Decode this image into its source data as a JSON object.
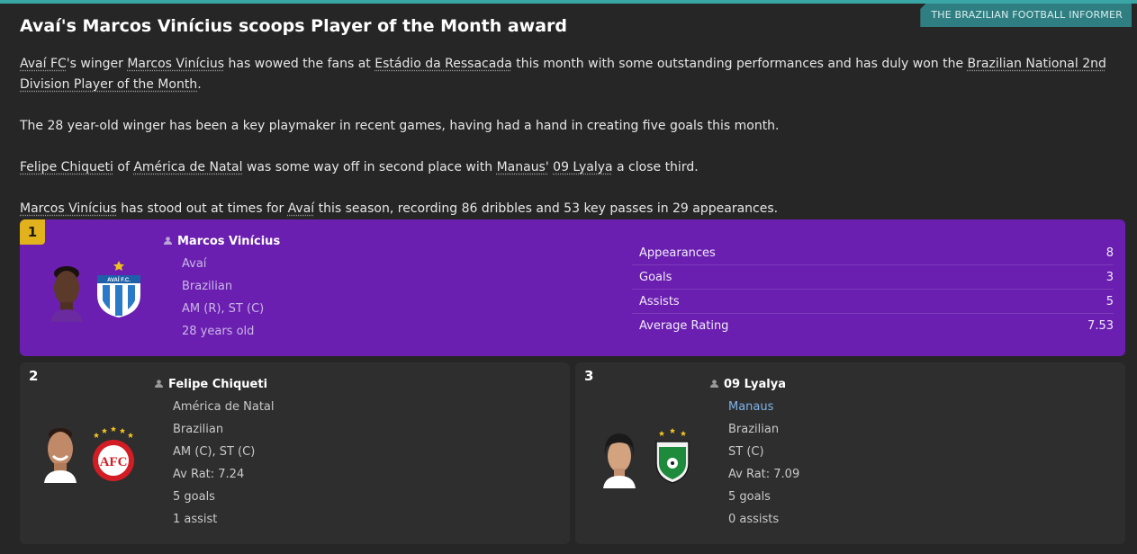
{
  "source": "THE BRAZILIAN FOOTBALL INFORMER",
  "headline": "Avaí's Marcos Vinícius scoops Player of the Month award",
  "article": {
    "p1": {
      "club": "Avaí FC",
      "t1": "'s winger ",
      "player": "Marcos Vinícius",
      "t2": " has wowed the fans at ",
      "stadium": "Estádio da Ressacada",
      "t3": " this month with some outstanding performances and has duly won the ",
      "award": "Brazilian National 2nd Division Player of the Month",
      "t4": "."
    },
    "p2": "The 28 year-old winger has been a key playmaker in recent games, having had a hand in creating five goals this month.",
    "p3": {
      "second_player": "Felipe Chiqueti",
      "t1": " of ",
      "second_club": "América de Natal",
      "t2": " was some way off in second place with ",
      "third_club": "Manaus'",
      "t3": " ",
      "third_player": "09 Lyalya",
      "t4": " a close third."
    },
    "p4": {
      "player": "Marcos Vinícius",
      "t1": " has stood out at times for ",
      "club": "Avaí",
      "t2": " this season, recording 86 dribbles and 53 key passes in 29 appearances."
    }
  },
  "first": {
    "rank": "1",
    "name": "Marcos Vinícius",
    "club": "Avaí",
    "nationality": "Brazilian",
    "position": "AM (R), ST (C)",
    "age": "28 years old",
    "crest_text": "AVAÍ F.C.",
    "icons": {
      "face": "player-face-icon",
      "crest": "avai-crest-icon",
      "person": "person-icon"
    },
    "stats": [
      {
        "label": "Appearances",
        "value": "8"
      },
      {
        "label": "Goals",
        "value": "3"
      },
      {
        "label": "Assists",
        "value": "5"
      },
      {
        "label": "Average Rating",
        "value": "7.53"
      }
    ]
  },
  "second": {
    "rank": "2",
    "name": "Felipe Chiqueti",
    "club": "América de Natal",
    "nationality": "Brazilian",
    "position": "AM (C), ST (C)",
    "rating": "Av Rat: 7.24",
    "goals": "5 goals",
    "assists": "1 assist",
    "crest_text": "AFC"
  },
  "third": {
    "rank": "3",
    "name": "09 Lyalya",
    "club": "Manaus",
    "nationality": "Brazilian",
    "position": "ST (C)",
    "rating": "Av Rat: 7.09",
    "goals": "5 goals",
    "assists": "0 assists"
  },
  "colors": {
    "first_panel": "#6a1fb0",
    "rank_badge": "#e2b21c",
    "source_tag": "#2f7f82",
    "accent_link": "#7fb4ea"
  }
}
